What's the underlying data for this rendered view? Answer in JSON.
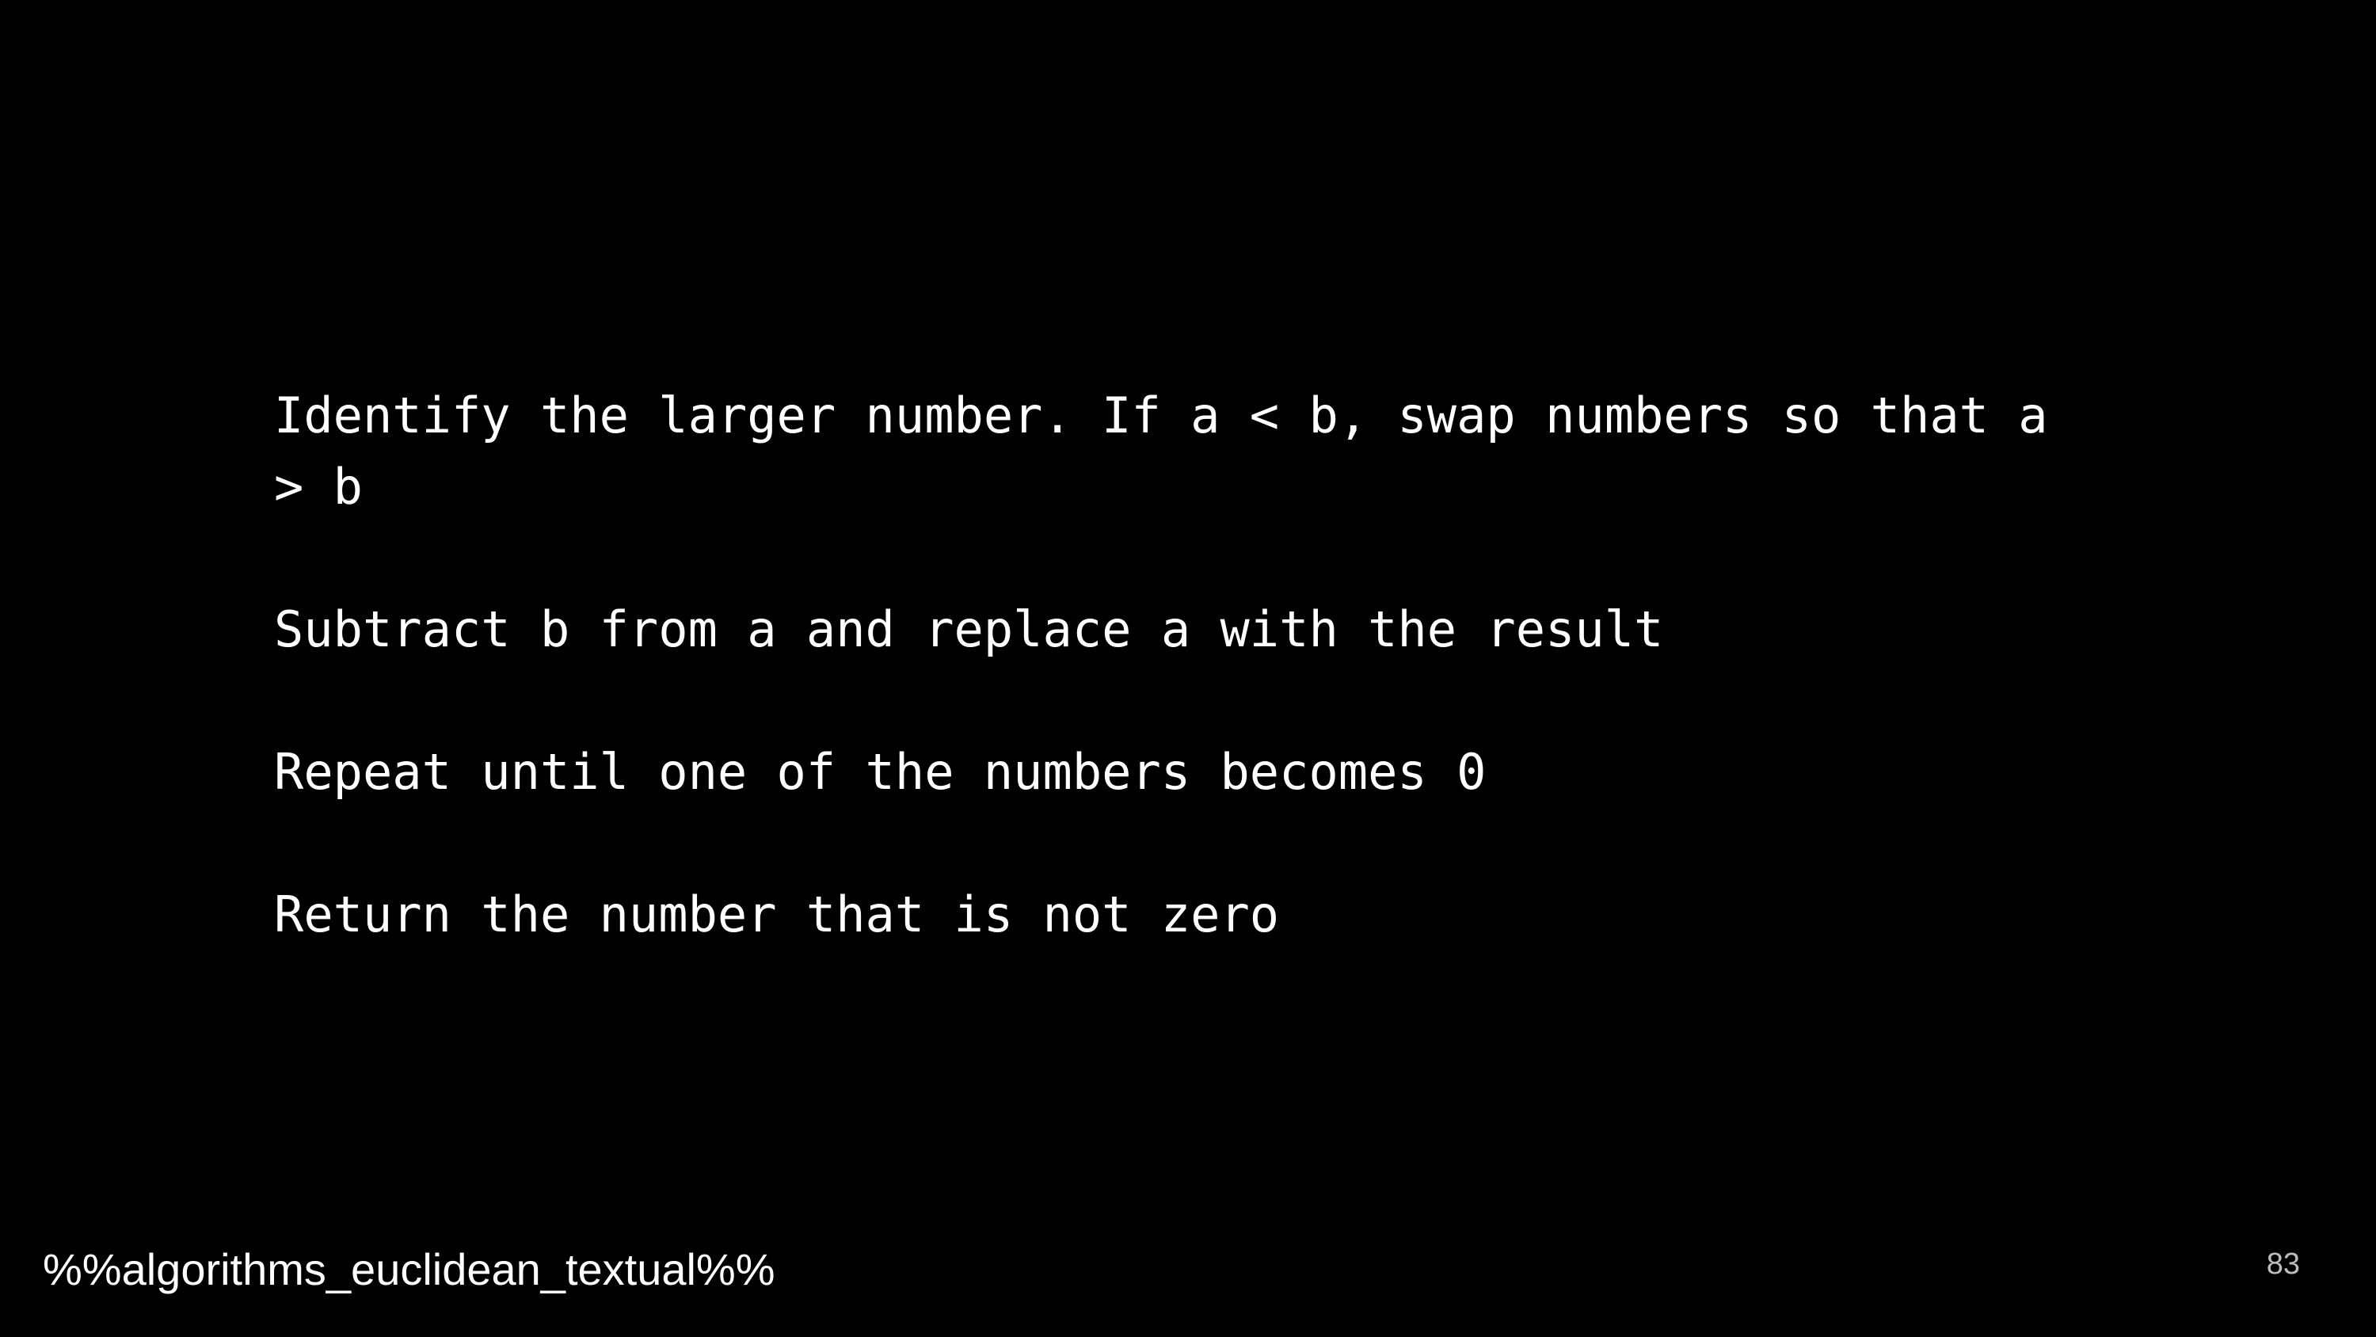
{
  "slide": {
    "steps": [
      "Identify the larger number. If a < b, swap numbers so that a > b",
      "Subtract b from a and replace a with the result",
      "Repeat until one of the numbers becomes 0",
      "Return the number that is not zero"
    ],
    "footer_tag": "%%algorithms_euclidean_textual%%",
    "page_number": "83"
  }
}
